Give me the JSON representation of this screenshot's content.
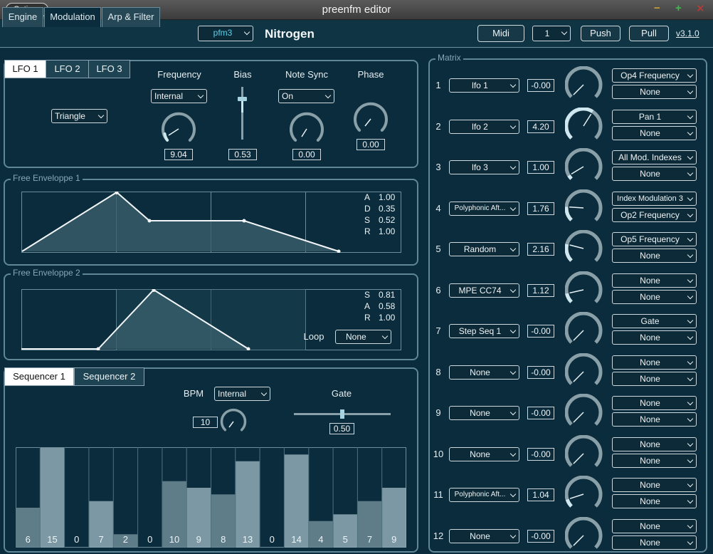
{
  "window": {
    "options_label": "Options",
    "title": "preenfm editor",
    "minimize": "−",
    "maximize": "+",
    "close": "✕"
  },
  "header": {
    "tabs": [
      "Engine",
      "Modulation",
      "Arp & Filter"
    ],
    "active_tab": "Modulation",
    "device_select": "pfm3",
    "patch_name": "Nitrogen",
    "midi_label": "Midi",
    "channel_select": "1",
    "push_label": "Push",
    "pull_label": "Pull",
    "version": "v3.1.0"
  },
  "lfo": {
    "tabs": [
      "LFO 1",
      "LFO 2",
      "LFO 3"
    ],
    "active_tab": "LFO 1",
    "shape_select": "Triangle",
    "frequency": {
      "label": "Frequency",
      "select": "Internal",
      "value": "9.04"
    },
    "bias": {
      "label": "Bias",
      "value": "0.53"
    },
    "note_sync": {
      "label": "Note Sync",
      "select": "On",
      "value": "0.00"
    },
    "phase": {
      "label": "Phase",
      "value": "0.00"
    }
  },
  "env1": {
    "title": "Free Enveloppe 1",
    "params": [
      {
        "name": "A",
        "value": "1.00"
      },
      {
        "name": "D",
        "value": "0.35"
      },
      {
        "name": "S",
        "value": "0.52"
      },
      {
        "name": "R",
        "value": "1.00"
      }
    ]
  },
  "env2": {
    "title": "Free Enveloppe 2",
    "params": [
      {
        "name": "S",
        "value": "0.81"
      },
      {
        "name": "A",
        "value": "0.58"
      },
      {
        "name": "R",
        "value": "1.00"
      }
    ],
    "loop_label": "Loop",
    "loop_select": "None"
  },
  "sequencer": {
    "tabs": [
      "Sequencer 1",
      "Sequencer 2"
    ],
    "active_tab": "Sequencer 1",
    "bpm_label": "BPM",
    "bpm_select": "Internal",
    "bpm_value": "10",
    "gate_label": "Gate",
    "gate_value": "0.50",
    "steps": [
      6,
      15,
      0,
      7,
      2,
      0,
      10,
      9,
      8,
      13,
      0,
      14,
      4,
      5,
      7,
      9
    ],
    "max_step": 15
  },
  "matrix": {
    "title": "Matrix",
    "rows": [
      {
        "num": "1",
        "source": "lfo 1",
        "value": "-0.00",
        "dest1": "Op4 Frequency",
        "dest2": "None"
      },
      {
        "num": "2",
        "source": "lfo 2",
        "value": "4.20",
        "dest1": "Pan 1",
        "dest2": "None"
      },
      {
        "num": "3",
        "source": "lfo 3",
        "value": "1.00",
        "dest1": "All Mod. Indexes",
        "dest2": "None"
      },
      {
        "num": "4",
        "source": "Polyphonic Aft...",
        "value": "1.76",
        "dest1": "Index Modulation 3",
        "dest2": "Op2 Frequency"
      },
      {
        "num": "5",
        "source": "Random",
        "value": "2.16",
        "dest1": "Op5 Frequency",
        "dest2": "None"
      },
      {
        "num": "6",
        "source": "MPE CC74",
        "value": "1.12",
        "dest1": "None",
        "dest2": "None"
      },
      {
        "num": "7",
        "source": "Step Seq 1",
        "value": "-0.00",
        "dest1": "Gate",
        "dest2": "None"
      },
      {
        "num": "8",
        "source": "None",
        "value": "-0.00",
        "dest1": "None",
        "dest2": "None"
      },
      {
        "num": "9",
        "source": "None",
        "value": "-0.00",
        "dest1": "None",
        "dest2": "None"
      },
      {
        "num": "10",
        "source": "None",
        "value": "-0.00",
        "dest1": "None",
        "dest2": "None"
      },
      {
        "num": "11",
        "source": "Polyphonic Aft...",
        "value": "1.04",
        "dest1": "None",
        "dest2": "None"
      },
      {
        "num": "12",
        "source": "None",
        "value": "-0.00",
        "dest1": "None",
        "dest2": "None"
      }
    ]
  }
}
